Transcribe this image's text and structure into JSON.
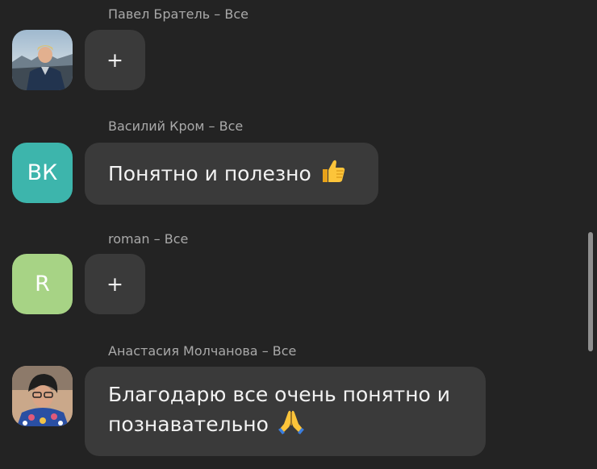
{
  "messages": [
    {
      "author": "Павел Братель",
      "recipient": "Все",
      "separator": " – ",
      "avatar_type": "photo",
      "bubble": "+"
    },
    {
      "author": "Василий Кром",
      "recipient": "Все",
      "separator": " – ",
      "avatar_type": "initials",
      "avatar_initials": "ВК",
      "avatar_color": "#3db5ac",
      "bubble": "Понятно и полезно",
      "emoji": "thumbs-up-icon"
    },
    {
      "author": "roman",
      "recipient": "Все",
      "separator": " – ",
      "avatar_type": "initials",
      "avatar_initials": "R",
      "avatar_color": "#a7d385",
      "bubble": "+"
    },
    {
      "author": "Анастасия Молчанова",
      "recipient": "Все",
      "separator": " – ",
      "avatar_type": "photo",
      "bubble_line1": "Благодарю все очень понятно и",
      "bubble_line2": "познавательно",
      "emoji": "praying-hands-icon"
    }
  ],
  "colors": {
    "background": "#232323",
    "bubble": "#3a3a3a",
    "meta_text": "#a9a9a9",
    "message_text": "#f2f2f2"
  }
}
